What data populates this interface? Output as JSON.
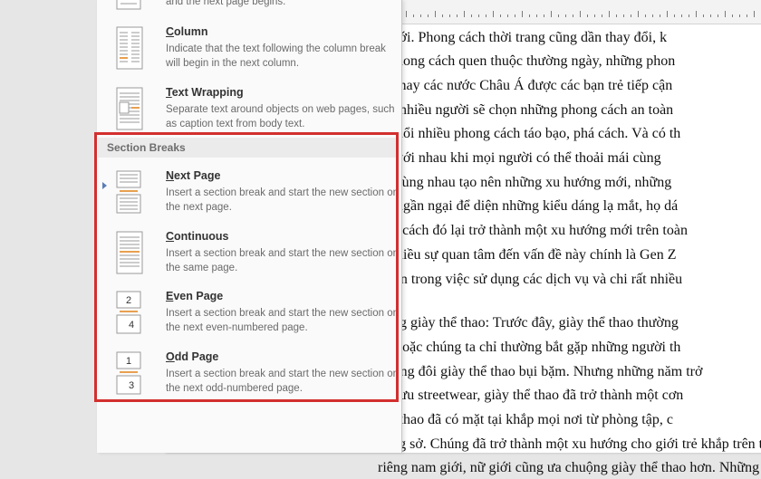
{
  "menu": {
    "top_fragment": "and the next page begins.",
    "items_top": [
      {
        "key": "column",
        "accel": "C",
        "rest": "olumn",
        "desc": "Indicate that the text following the column break will begin in the next column.",
        "icon": "column-break-icon"
      },
      {
        "key": "text-wrapping",
        "accel": "T",
        "rest": "ext Wrapping",
        "desc": "Separate text around objects on web pages, such as caption text from body text.",
        "icon": "text-wrapping-icon"
      }
    ],
    "section_header": "Section Breaks",
    "items_section": [
      {
        "key": "next-page",
        "accel": "N",
        "rest": "ext Page",
        "desc": "Insert a section break and start the new section on the next page.",
        "icon": "next-page-break-icon"
      },
      {
        "key": "continuous",
        "accel": "C",
        "rest": "ontinuous",
        "desc": "Insert a section break and start the new section on the same page.",
        "icon": "continuous-break-icon"
      },
      {
        "key": "even-page",
        "accel": "E",
        "rest": "ven Page",
        "desc": "Insert a section break and start the new section on the next even-numbered page.",
        "icon": "even-page-break-icon",
        "num_top": "2",
        "num_bottom": "4"
      },
      {
        "key": "odd-page",
        "accel": "O",
        "rest": "dd Page",
        "desc": "Insert a section break and start the new section on the next odd-numbered page.",
        "icon": "odd-page-break-icon",
        "num_top": "1",
        "num_bottom": "3"
      }
    ]
  },
  "document": {
    "lines": [
      "ế giới. Phong cách thời trang cũng dần thay đổi, k",
      "g phong cách quen thuộc thường ngày, những phon",
      "Âu hay các nước Châu Á được các bạn trẻ tiếp cận",
      "nh, nhiều người sẽ chọn những phong cách an toàn",
      "o đuổi nhiều phong cách táo bạo, phá cách. Và có th",
      "lại với nhau khi mọi người có thể thoải mái cùng",
      "lạ, cùng nhau tạo nên những xu hướng mới, những",
      "ng ngần ngại để diện những kiểu dáng lạ mắt, họ dá",
      "phá cách đó lại trở thành một xu hướng mới trên toàn",
      "n nhiều sự quan tâm đến vấn đề này chính là Gen Z",
      "n lớn trong việc sử dụng các dịch vụ và chi rất nhiều",
      "",
      "dụng giày thể thao: Trước đây, giày thể thao thường",
      "ao hoặc chúng ta chỉ thường bắt gặp những người th",
      "những đôi giày thể thao bụi bặm. Nhưng những năm trở",
      "ao lưu streetwear, giày thể thao đã trở thành một cơn",
      "thể thao đã có mặt tại khắp mọi nơi từ phòng tập, c",
      "công sở. Chúng đã trở thành một xu hướng cho giới trẻ khắp trên th",
      "riêng nam giới, nữ giới cũng ưa chuộng giày thể thao hơn. Những phụ"
    ]
  },
  "colors": {
    "highlight": "#d32f2f",
    "icon_accent": "#e8a050"
  }
}
